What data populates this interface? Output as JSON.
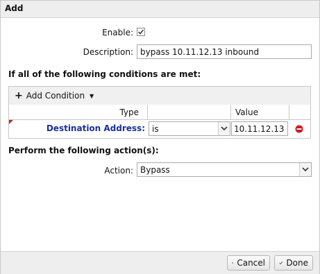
{
  "dialog": {
    "title": "Add",
    "enable_label": "Enable:",
    "enable_checked": true,
    "description_label": "Description:",
    "description_value": "bypass 10.11.12.13 inbound",
    "conditions_heading": "If all of the following conditions are met:",
    "add_condition_label": "Add Condition",
    "columns": {
      "type": "Type",
      "value": "Value"
    },
    "condition": {
      "field_label": "Destination Address:",
      "operator": "is",
      "value": "10.11.12.13"
    },
    "actions_heading": "Perform the following action(s):",
    "action_label": "Action:",
    "action_value": "Bypass",
    "cancel_label": "Cancel",
    "done_label": "Done"
  }
}
